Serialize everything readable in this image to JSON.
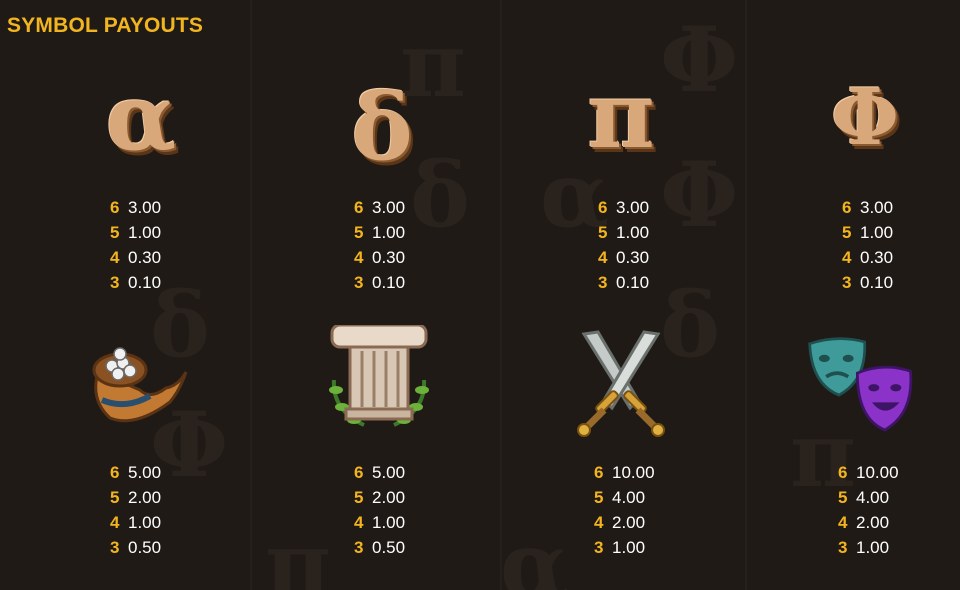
{
  "title": "SYMBOL PAYOUTS",
  "colors": {
    "accent": "#f3b51f",
    "text": "#ffffff",
    "background": "#1f1a16"
  },
  "symbols": [
    {
      "name": "alpha",
      "glyph": "α",
      "payouts": [
        {
          "count": "6",
          "value": "3.00"
        },
        {
          "count": "5",
          "value": "1.00"
        },
        {
          "count": "4",
          "value": "0.30"
        },
        {
          "count": "3",
          "value": "0.10"
        }
      ]
    },
    {
      "name": "delta",
      "glyph": "δ",
      "payouts": [
        {
          "count": "6",
          "value": "3.00"
        },
        {
          "count": "5",
          "value": "1.00"
        },
        {
          "count": "4",
          "value": "0.30"
        },
        {
          "count": "3",
          "value": "0.10"
        }
      ]
    },
    {
      "name": "pi",
      "glyph": "π",
      "payouts": [
        {
          "count": "6",
          "value": "3.00"
        },
        {
          "count": "5",
          "value": "1.00"
        },
        {
          "count": "4",
          "value": "0.30"
        },
        {
          "count": "3",
          "value": "0.10"
        }
      ]
    },
    {
      "name": "phi",
      "glyph": "Φ",
      "payouts": [
        {
          "count": "6",
          "value": "3.00"
        },
        {
          "count": "5",
          "value": "1.00"
        },
        {
          "count": "4",
          "value": "0.30"
        },
        {
          "count": "3",
          "value": "0.10"
        }
      ]
    },
    {
      "name": "horn",
      "icon": "cornucopia-icon",
      "payouts": [
        {
          "count": "6",
          "value": "5.00"
        },
        {
          "count": "5",
          "value": "2.00"
        },
        {
          "count": "4",
          "value": "1.00"
        },
        {
          "count": "3",
          "value": "0.50"
        }
      ]
    },
    {
      "name": "column",
      "icon": "laurel-column-icon",
      "payouts": [
        {
          "count": "6",
          "value": "5.00"
        },
        {
          "count": "5",
          "value": "2.00"
        },
        {
          "count": "4",
          "value": "1.00"
        },
        {
          "count": "3",
          "value": "0.50"
        }
      ]
    },
    {
      "name": "swords",
      "icon": "crossed-swords-icon",
      "payouts": [
        {
          "count": "6",
          "value": "10.00"
        },
        {
          "count": "5",
          "value": "4.00"
        },
        {
          "count": "4",
          "value": "2.00"
        },
        {
          "count": "3",
          "value": "1.00"
        }
      ]
    },
    {
      "name": "masks",
      "icon": "theater-masks-icon",
      "payouts": [
        {
          "count": "6",
          "value": "10.00"
        },
        {
          "count": "5",
          "value": "4.00"
        },
        {
          "count": "4",
          "value": "2.00"
        },
        {
          "count": "3",
          "value": "1.00"
        }
      ]
    }
  ]
}
